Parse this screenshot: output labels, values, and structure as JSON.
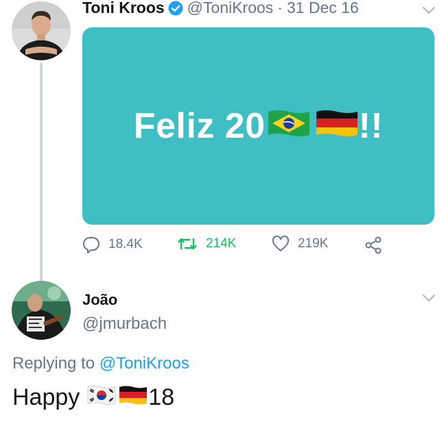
{
  "tweet": {
    "author_name": "Toni Kroos",
    "author_handle": "@ToniKroos",
    "separator": "·",
    "date": "31 Dec 16",
    "media_text_prefix": "Feliz 20",
    "media_text_suffix": "!!",
    "media_bg_color": "#3fbec3",
    "flags": [
      "brazil-flag-icon",
      "germany-flag-icon"
    ],
    "replies_count": "18.4K",
    "retweets_count": "214K",
    "likes_count": "219K",
    "verified": true
  },
  "reply": {
    "author_name": "João",
    "author_handle": "@jmurbach",
    "replying_prefix": "Replying to",
    "replying_to": "@ToniKroos",
    "text_prefix": "Happy",
    "text_suffix": "18",
    "flags": [
      "south-korea-flag-icon",
      "germany-flag-icon"
    ]
  },
  "colors": {
    "accent": "#1da1f2",
    "retweet_green": "#17bf63",
    "secondary_text": "#657786",
    "thread_line": "#ccd6dd"
  }
}
